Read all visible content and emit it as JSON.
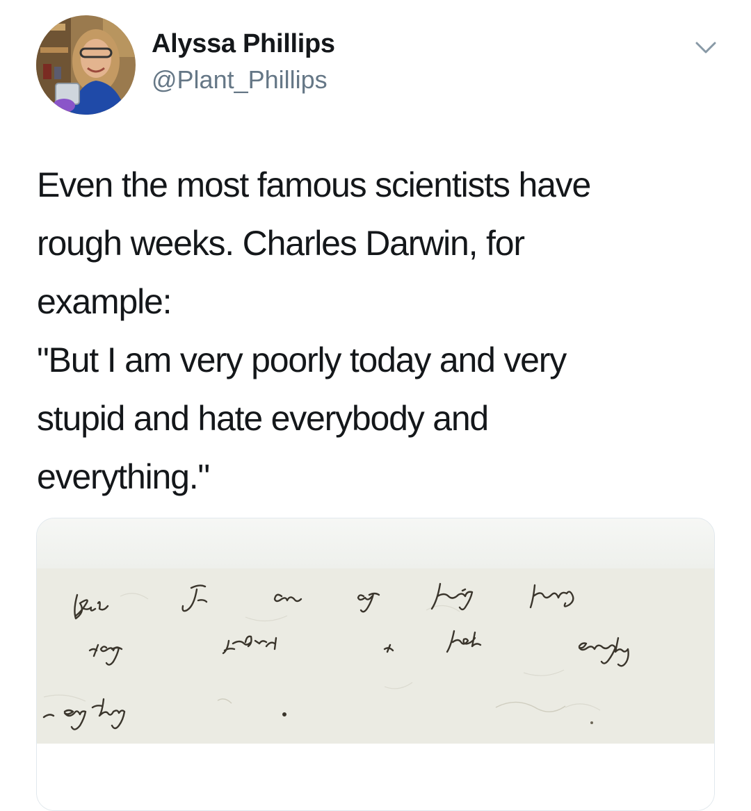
{
  "author": {
    "name": "Alyssa Phillips",
    "handle": "@Plant_Phillips"
  },
  "tweet": {
    "lines": [
      "Even the most famous scientists have",
      "rough weeks. Charles Darwin, for",
      "example:",
      "\"But I am very poorly today and very",
      "stupid and hate everybody and",
      "everything.\""
    ]
  },
  "icons": {
    "menu": "chevron-down-icon",
    "avatar": "profile-photo"
  },
  "colors": {
    "text": "#14171a",
    "secondary": "#657786",
    "border": "#e1e8ed",
    "paper": "#ebebe3",
    "ink": "#3a352c"
  }
}
